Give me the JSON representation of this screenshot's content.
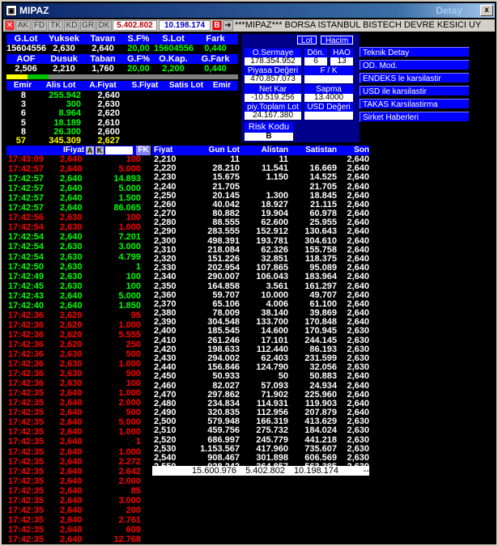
{
  "window": {
    "title": "MIPAZ",
    "right_title": "Detay",
    "close": "x",
    "icon": "app-icon"
  },
  "toolbar": {
    "buttons": [
      "AK",
      "FD",
      "TK",
      "KD",
      "GR",
      "DK"
    ],
    "val1": "5.402.802",
    "val2": "10.198.174",
    "b_label": "B",
    "marquee": "***MIPAZ*** BORSA ISTANBUL BISTECH DEVRE KESICI UY"
  },
  "summary": {
    "h1": [
      "G.Lot",
      "Yuksek",
      "Tavan",
      "S.F%",
      "S.Lot",
      "Fark"
    ],
    "v1": [
      "15604556",
      "2,630",
      "2,640",
      "20,00",
      "15604556",
      "0,440"
    ],
    "h2": [
      "AOF",
      "Dusuk",
      "Taban",
      "G.F%",
      "O.Kap.",
      "G.Fark"
    ],
    "v2": [
      "2,506",
      "2,210",
      "1,760",
      "20,00",
      "2,200",
      "0,440"
    ]
  },
  "depth": {
    "headers": [
      "Emir",
      "Alis Lot",
      "A.Fiyat",
      "S.Fiyat",
      "Satis Lot",
      "Emir"
    ],
    "rows": [
      [
        "8",
        "255.942",
        "2,640"
      ],
      [
        "3",
        "300",
        "2,630"
      ],
      [
        "6",
        "8.964",
        "2,620"
      ],
      [
        "5",
        "18.189",
        "2,610"
      ],
      [
        "8",
        "26.300",
        "2,600"
      ],
      [
        "57",
        "345.309",
        "2,627"
      ]
    ]
  },
  "detail": {
    "lot_btn": "Lot",
    "hacim_btn": "Hacim",
    "o_sermaye": "O.Sermaye",
    "o_sermaye_v": "178.354.952",
    "don": "Dön.",
    "don_v": "6",
    "hao": "HAO",
    "hao_v": "13",
    "piyasa": "Piyasa Değeri",
    "piyasa_v": "470.857.073",
    "fk": "F / K",
    "fk_v": "",
    "netkar": "Net Kar",
    "netkar_v": "-10.519.256",
    "sapma": "Sapma",
    "sapma_v": "13.4000",
    "toplam": "piy.Toplam Lot",
    "toplam_v": "24.167.380",
    "usd": "USD Değeri",
    "usd_v": "",
    "risk": "Risk Kodu",
    "risk_v": "B"
  },
  "menu": [
    "Teknik Detay",
    "OD. Mod.",
    "ENDEKS le karsilastir",
    "USD ile karsilastir",
    "TAKAS Karsilastirma",
    "Sirket Haberleri"
  ],
  "trades": {
    "header": "IFiyat",
    "a": "A",
    "k": "K",
    "fk": "FK",
    "rows": [
      [
        "17:43:09",
        "2,640",
        "100",
        "r"
      ],
      [
        "17:42:57",
        "2,640",
        "5.000",
        "r"
      ],
      [
        "17:42:57",
        "2,640",
        "14.893",
        "g"
      ],
      [
        "17:42:57",
        "2,640",
        "5.000",
        "g"
      ],
      [
        "17:42:57",
        "2,640",
        "1.500",
        "g"
      ],
      [
        "17:42:57",
        "2,640",
        "86.065",
        "g"
      ],
      [
        "17:42:56",
        "2,630",
        "100",
        "r"
      ],
      [
        "17:42:54",
        "2,630",
        "1.000",
        "r"
      ],
      [
        "17:42:54",
        "2,640",
        "7.201",
        "g"
      ],
      [
        "17:42:54",
        "2,630",
        "3.000",
        "g"
      ],
      [
        "17:42:54",
        "2,630",
        "4.799",
        "g"
      ],
      [
        "17:42:50",
        "2,630",
        "1",
        "g"
      ],
      [
        "17:42:49",
        "2,630",
        "100",
        "g"
      ],
      [
        "17:42:45",
        "2,630",
        "100",
        "g"
      ],
      [
        "17:42:43",
        "2,640",
        "5.000",
        "g"
      ],
      [
        "17:42:40",
        "2,640",
        "1.850",
        "g"
      ],
      [
        "17:42:36",
        "2,620",
        "95",
        "r"
      ],
      [
        "17:42:36",
        "2,620",
        "1.000",
        "r"
      ],
      [
        "17:42:36",
        "2,620",
        "5.555",
        "r"
      ],
      [
        "17:42:36",
        "2,620",
        "250",
        "r"
      ],
      [
        "17:42:36",
        "2,630",
        "500",
        "r"
      ],
      [
        "17:42:36",
        "2,630",
        "1.000",
        "r"
      ],
      [
        "17:42:36",
        "2,630",
        "500",
        "r"
      ],
      [
        "17:42:36",
        "2,630",
        "100",
        "r"
      ],
      [
        "17:42:35",
        "2,640",
        "1.000",
        "r"
      ],
      [
        "17:42:35",
        "2,640",
        "2.000",
        "r"
      ],
      [
        "17:42:35",
        "2,640",
        "500",
        "r"
      ],
      [
        "17:42:35",
        "2,640",
        "5.000",
        "r"
      ],
      [
        "17:42:35",
        "2,640",
        "1.000",
        "r"
      ],
      [
        "17:42:35",
        "2,640",
        "1",
        "r"
      ],
      [
        "17:42:35",
        "2,640",
        "1.000",
        "r"
      ],
      [
        "17:42:35",
        "2,640",
        "2.272",
        "r"
      ],
      [
        "17:42:35",
        "2,640",
        "2.642",
        "r"
      ],
      [
        "17:42:35",
        "2,640",
        "2.000",
        "r"
      ],
      [
        "17:42:35",
        "2,640",
        "85",
        "r"
      ],
      [
        "17:42:35",
        "2,640",
        "3.000",
        "r"
      ],
      [
        "17:42:35",
        "2,640",
        "200",
        "r"
      ],
      [
        "17:42:35",
        "2,640",
        "2.761",
        "r"
      ],
      [
        "17:42:35",
        "2,640",
        "609",
        "r"
      ],
      [
        "17:42:35",
        "2,640",
        "12.768",
        "r"
      ]
    ]
  },
  "dist": {
    "headers": [
      "Fiyat",
      "Gun Lot",
      "Alistan",
      "Satistan",
      "Son"
    ],
    "rows": [
      [
        "2,210",
        "11",
        "11",
        "",
        "2,640"
      ],
      [
        "2,220",
        "28.210",
        "11.541",
        "16.669",
        "2,640"
      ],
      [
        "2,230",
        "15.675",
        "1.150",
        "14.525",
        "2,640"
      ],
      [
        "2,240",
        "21.705",
        "",
        "21.705",
        "2,640"
      ],
      [
        "2,250",
        "20.145",
        "1.300",
        "18.845",
        "2,640"
      ],
      [
        "2,260",
        "40.042",
        "18.927",
        "21.115",
        "2,640"
      ],
      [
        "2,270",
        "80.882",
        "19.904",
        "60.978",
        "2,640"
      ],
      [
        "2,280",
        "88.555",
        "62.600",
        "25.955",
        "2,640"
      ],
      [
        "2,290",
        "283.555",
        "152.912",
        "130.643",
        "2,640"
      ],
      [
        "2,300",
        "498.391",
        "193.781",
        "304.610",
        "2,640"
      ],
      [
        "2,310",
        "218.084",
        "62.326",
        "155.758",
        "2,640"
      ],
      [
        "2,320",
        "151.226",
        "32.851",
        "118.375",
        "2,640"
      ],
      [
        "2,330",
        "202.954",
        "107.865",
        "95.089",
        "2,640"
      ],
      [
        "2,340",
        "290.007",
        "106.043",
        "183.964",
        "2,640"
      ],
      [
        "2,350",
        "164.858",
        "3.561",
        "161.297",
        "2,640"
      ],
      [
        "2,360",
        "59.707",
        "10.000",
        "49.707",
        "2,640"
      ],
      [
        "2,370",
        "65.106",
        "4.006",
        "61.100",
        "2,640"
      ],
      [
        "2,380",
        "78.009",
        "38.140",
        "39.869",
        "2,640"
      ],
      [
        "2,390",
        "304.548",
        "133.700",
        "170.848",
        "2,640"
      ],
      [
        "2,400",
        "185.545",
        "14.600",
        "170.945",
        "2,630"
      ],
      [
        "2,410",
        "261.246",
        "17.101",
        "244.145",
        "2,630"
      ],
      [
        "2,420",
        "198.633",
        "112.440",
        "86.193",
        "2,630"
      ],
      [
        "2,430",
        "294.002",
        "62.403",
        "231.599",
        "2,630"
      ],
      [
        "2,440",
        "156.846",
        "124.790",
        "32.056",
        "2,630"
      ],
      [
        "2,450",
        "50.933",
        "50",
        "50.883",
        "2,640"
      ],
      [
        "2,460",
        "82.027",
        "57.093",
        "24.934",
        "2,640"
      ],
      [
        "2,470",
        "297.862",
        "71.902",
        "225.960",
        "2,640"
      ],
      [
        "2,480",
        "234.834",
        "114.931",
        "119.903",
        "2,640"
      ],
      [
        "2,490",
        "320.835",
        "112.956",
        "207.879",
        "2,640"
      ],
      [
        "2,500",
        "579.948",
        "166.319",
        "413.629",
        "2,630"
      ],
      [
        "2,510",
        "459.756",
        "275.732",
        "184.024",
        "2,630"
      ],
      [
        "2,520",
        "686.997",
        "245.779",
        "441.218",
        "2,630"
      ],
      [
        "2,530",
        "1.153.567",
        "417.960",
        "735.607",
        "2,630"
      ],
      [
        "2,540",
        "908.467",
        "301.898",
        "606.569",
        "2,630"
      ],
      [
        "2,550",
        "928.242",
        "364.857",
        "563.385",
        "2,630"
      ]
    ],
    "totals": [
      "15.600.976",
      "5.402.802",
      "10.198.174",
      "--"
    ]
  }
}
